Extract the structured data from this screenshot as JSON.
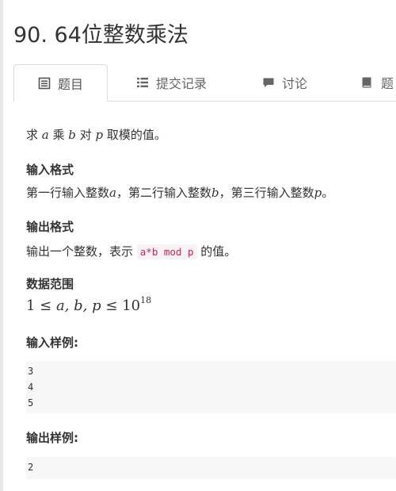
{
  "problem": {
    "title": "90. 64位整数乘法"
  },
  "tabs": [
    {
      "label": "题目",
      "icon": "document-icon",
      "active": true
    },
    {
      "label": "提交记录",
      "icon": "list-icon",
      "active": false
    },
    {
      "label": "讨论",
      "icon": "comment-icon",
      "active": false
    },
    {
      "label": "题",
      "icon": "book-icon",
      "active": false
    }
  ],
  "statement": {
    "t1": "求 ",
    "v1": "a",
    "t2": " 乘 ",
    "v2": "b",
    "t3": " 对 ",
    "v3": "p",
    "t4": " 取模的值。"
  },
  "input_format": {
    "heading": "输入格式",
    "t1": "第一行输入整数",
    "v1": "a",
    "t2": "，第二行输入整数",
    "v2": "b",
    "t3": "，第三行输入整数",
    "v3": "p",
    "t4": "。"
  },
  "output_format": {
    "heading": "输出格式",
    "t1": "输出一个整数，表示 ",
    "code": "a*b mod p",
    "t2": " 的值。"
  },
  "data_range": {
    "heading": "数据范围",
    "lhs": "1 ≤ ",
    "vars": "a, b, p",
    "rel": " ≤ 10",
    "exp": "18"
  },
  "sample_input": {
    "heading": "输入样例:",
    "lines": [
      "3",
      "4",
      "5"
    ]
  },
  "sample_output": {
    "heading": "输出样例:",
    "lines": [
      "2"
    ]
  }
}
